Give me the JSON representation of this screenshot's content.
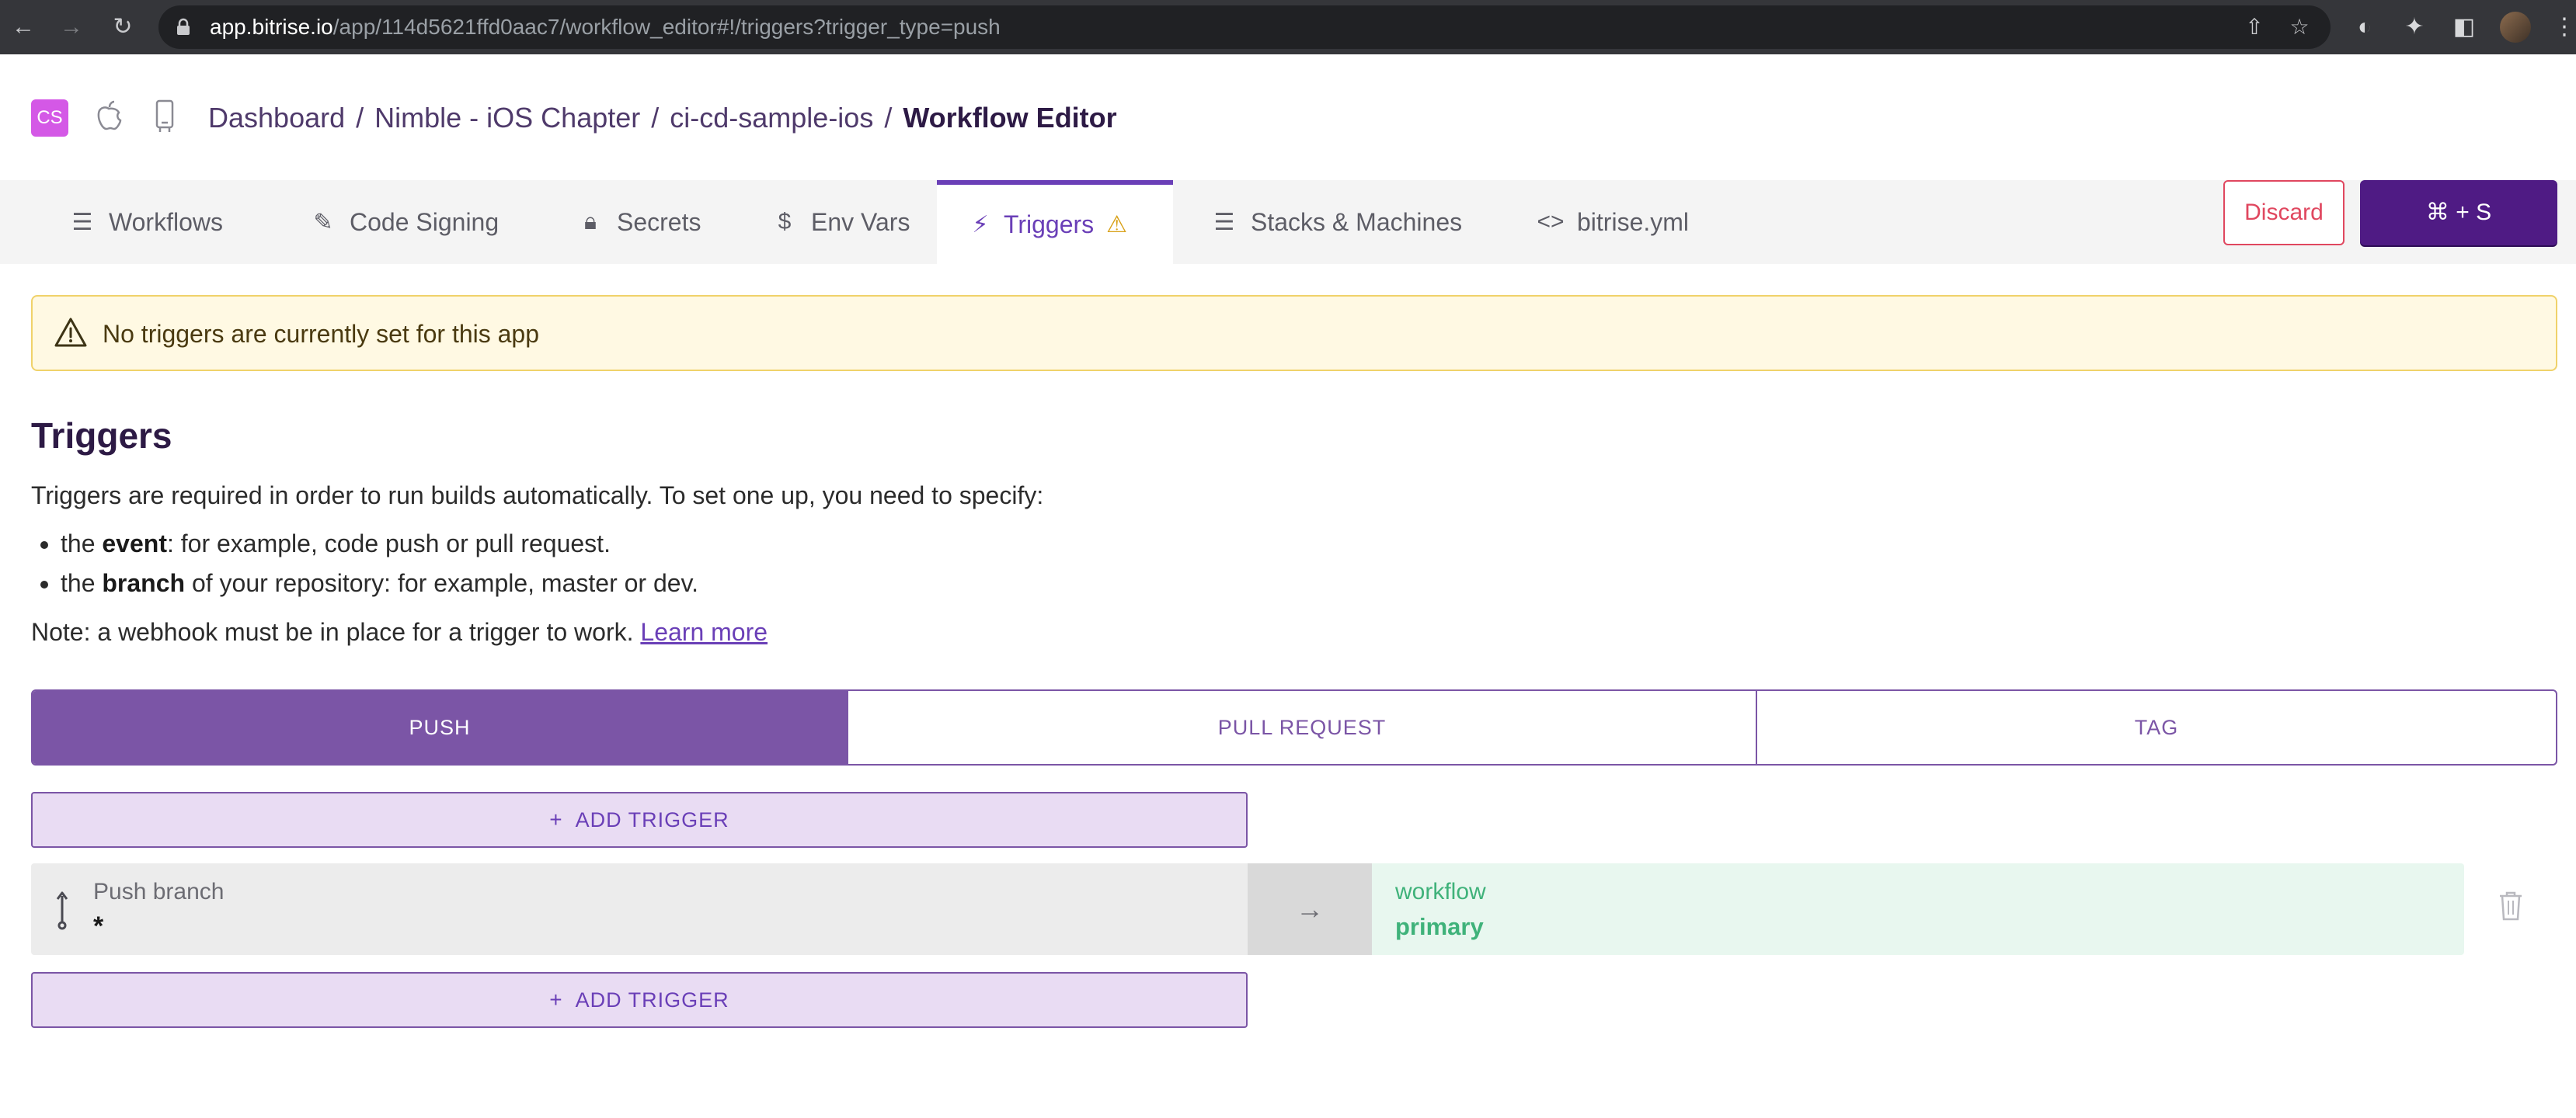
{
  "browser": {
    "url_host": "app.bitrise.io",
    "url_path": "/app/114d5621ffd0aac7/workflow_editor#!/triggers?trigger_type=push"
  },
  "app": {
    "badge": "CS"
  },
  "breadcrumb": {
    "items": [
      "Dashboard",
      "Nimble - iOS Chapter",
      "ci-cd-sample-ios"
    ],
    "separator": "/",
    "current": "Workflow Editor"
  },
  "tabs": [
    {
      "label": "Workflows",
      "icon": "list-icon"
    },
    {
      "label": "Code Signing",
      "icon": "edit-icon"
    },
    {
      "label": "Secrets",
      "icon": "lock-icon"
    },
    {
      "label": "Env Vars",
      "icon": "dollar-icon"
    },
    {
      "label": "Triggers",
      "icon": "bolt-icon",
      "active": true,
      "warning": true
    },
    {
      "label": "Stacks & Machines",
      "icon": "layers-icon"
    },
    {
      "label": "bitrise.yml",
      "icon": "code-icon"
    }
  ],
  "actions": {
    "discard_label": "Discard",
    "save_label": "⌘ + S"
  },
  "alert": {
    "text": "No triggers are currently set for this app"
  },
  "content": {
    "heading": "Triggers",
    "intro": "Triggers are required in order to run builds automatically. To set one up, you need to specify:",
    "bullets": [
      {
        "prefix": "the ",
        "strong": "event",
        "suffix": ": for example, code push or pull request."
      },
      {
        "prefix": "the ",
        "strong": "branch",
        "suffix": " of your repository: for example, master or dev."
      }
    ],
    "note": "Note: a webhook must be in place for a trigger to work. ",
    "learn_more": "Learn more"
  },
  "trigger_types": [
    {
      "label": "PUSH",
      "active": true
    },
    {
      "label": "PULL REQUEST",
      "active": false
    },
    {
      "label": "TAG",
      "active": false
    }
  ],
  "add_trigger_label": "ADD TRIGGER",
  "add_trigger_plus": "+",
  "trigger": {
    "type_label": "Push branch",
    "branch": "*",
    "workflow_label": "workflow",
    "workflow": "primary"
  },
  "colors": {
    "brand_purple": "#4f1b84",
    "accent_purple": "#7b55a6",
    "danger": "#e0475f",
    "warning": "#f0d26a",
    "success": "#3fb27a"
  }
}
